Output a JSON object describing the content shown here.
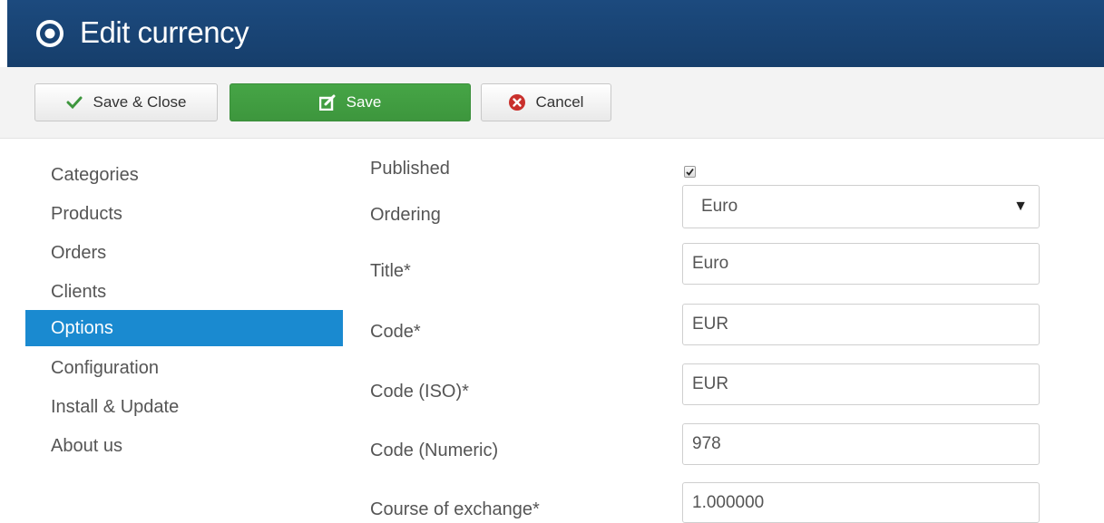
{
  "header": {
    "title": "Edit currency",
    "icon": "target-icon"
  },
  "toolbar": {
    "save_close_label": "Save & Close",
    "save_label": "Save",
    "cancel_label": "Cancel"
  },
  "sidebar": {
    "items": [
      {
        "label": "Categories",
        "active": false
      },
      {
        "label": "Products",
        "active": false
      },
      {
        "label": "Orders",
        "active": false
      },
      {
        "label": "Clients",
        "active": false
      },
      {
        "label": "Options",
        "active": true
      },
      {
        "label": "Configuration",
        "active": false
      },
      {
        "label": "Install & Update",
        "active": false
      },
      {
        "label": "About us",
        "active": false
      }
    ]
  },
  "form": {
    "published": {
      "label": "Published",
      "checked": true
    },
    "ordering": {
      "label": "Ordering",
      "value": "Euro"
    },
    "title": {
      "label": "Title*",
      "value": "Euro"
    },
    "code": {
      "label": "Code*",
      "value": "EUR"
    },
    "code_iso": {
      "label": "Code (ISO)*",
      "value": "EUR"
    },
    "code_numeric": {
      "label": "Code (Numeric)",
      "value": "978"
    },
    "course": {
      "label": "Course of exchange*",
      "value": "1.000000"
    }
  },
  "colors": {
    "header_bg": "#1c4a7e",
    "save_bg": "#46a546",
    "active_item": "#1a8ad0",
    "cancel_icon": "#c9302c"
  }
}
